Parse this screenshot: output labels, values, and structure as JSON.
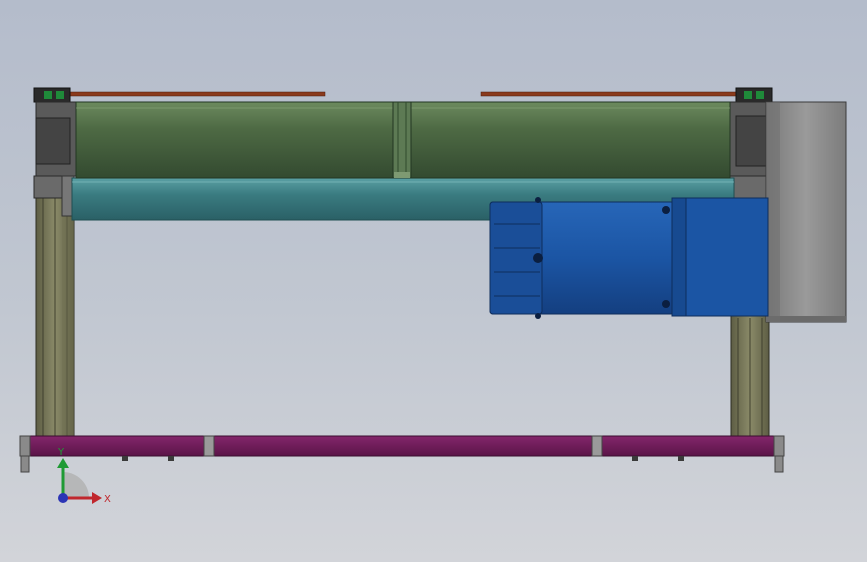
{
  "scene": {
    "colors": {
      "frame": "#7e7e5e",
      "frame_dark": "#4e4e38",
      "roller_upper": "#4e6a44",
      "roller_lower": "#3a7b80",
      "motor": "#1b55a4",
      "gearbox": "#8d8d8d",
      "base_rail": "#6a1b56",
      "guide_rod": "#8a3a1c",
      "bracket": "#5a5a5a"
    },
    "triad": {
      "x_label": "X",
      "y_label": "Y",
      "x_color": "#c0272d",
      "y_color": "#1f9a34",
      "z_color": "#2b34b5"
    }
  }
}
